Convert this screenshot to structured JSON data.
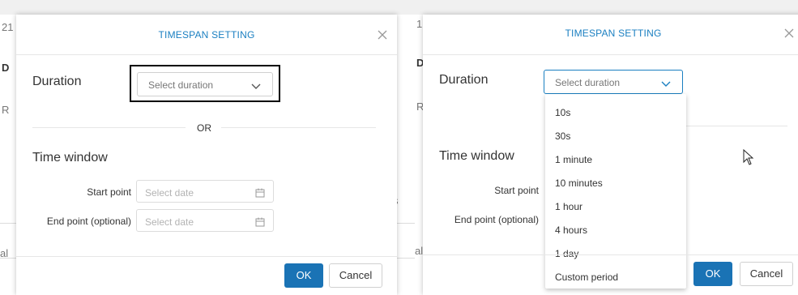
{
  "background": {
    "left_chars": [
      "21",
      "D",
      "R",
      "al"
    ],
    "right_chars": [
      "1",
      "D",
      "R",
      "al"
    ],
    "mid_char": "s"
  },
  "left_dialog": {
    "title": "TIMESPAN SETTING",
    "duration_label": "Duration",
    "duration_placeholder": "Select duration",
    "or_text": "OR",
    "time_window_label": "Time window",
    "start_label": "Start point",
    "start_placeholder": "Select date",
    "end_label": "End point (optional)",
    "end_placeholder": "Select date",
    "ok_label": "OK",
    "cancel_label": "Cancel"
  },
  "right_dialog": {
    "title": "TIMESPAN SETTING",
    "duration_label": "Duration",
    "duration_placeholder": "Select duration",
    "time_window_label": "Time window",
    "start_label": "Start point",
    "end_label": "End point (optional)",
    "ok_label": "OK",
    "cancel_label": "Cancel",
    "dropdown_options": [
      "10s",
      "30s",
      "1 minute",
      "10 minutes",
      "1 hour",
      "4 hours",
      "1 day",
      "Custom period"
    ]
  },
  "colors": {
    "accent": "#1a7fc1",
    "ok_button": "#1a73b5",
    "highlight_border": "#000000"
  },
  "icons": {
    "close": "close-icon",
    "chevron": "chevron-down-icon",
    "calendar": "calendar-icon",
    "cursor": "mouse-cursor-icon"
  }
}
